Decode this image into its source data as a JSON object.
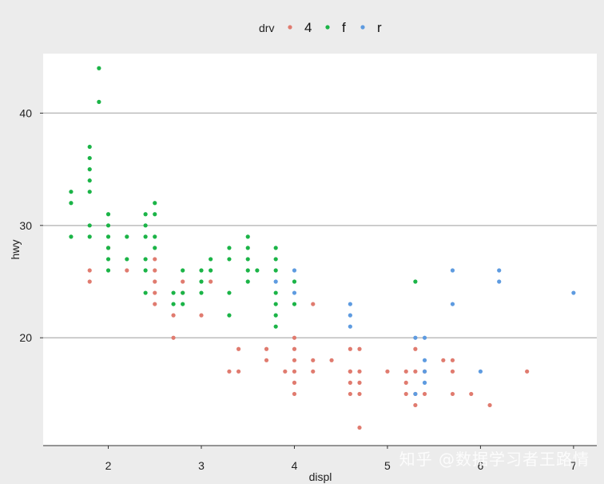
{
  "legend": {
    "title": "drv",
    "entries": [
      {
        "label": "4",
        "color": "#E07B6F"
      },
      {
        "label": "f",
        "color": "#1BB447"
      },
      {
        "label": "r",
        "color": "#5E9BE0"
      }
    ]
  },
  "watermark": "知乎 @数据学习者王路情",
  "chart_data": {
    "type": "scatter",
    "xlabel": "displ",
    "ylabel": "hwy",
    "xlim": [
      1.3,
      7.25
    ],
    "ylim": [
      10.4,
      45.3
    ],
    "xticks": [
      2,
      3,
      4,
      5,
      6,
      7
    ],
    "yticks": [
      20,
      30,
      40
    ],
    "grid": "horizontal-only",
    "legend_position": "top",
    "series": [
      {
        "name": "4",
        "color": "#E07B6F",
        "points": [
          [
            1.8,
            26
          ],
          [
            1.8,
            25
          ],
          [
            2.0,
            28
          ],
          [
            2.2,
            26
          ],
          [
            2.5,
            27
          ],
          [
            2.5,
            26
          ],
          [
            2.5,
            25
          ],
          [
            2.5,
            24
          ],
          [
            2.5,
            23
          ],
          [
            2.7,
            22
          ],
          [
            2.7,
            20
          ],
          [
            2.8,
            25
          ],
          [
            2.8,
            24
          ],
          [
            3.0,
            22
          ],
          [
            3.1,
            25
          ],
          [
            3.3,
            17
          ],
          [
            3.4,
            19
          ],
          [
            3.4,
            17
          ],
          [
            3.7,
            19
          ],
          [
            3.7,
            18
          ],
          [
            3.9,
            17
          ],
          [
            4.0,
            20
          ],
          [
            4.0,
            19
          ],
          [
            4.0,
            18
          ],
          [
            4.0,
            17
          ],
          [
            4.0,
            16
          ],
          [
            4.0,
            15
          ],
          [
            4.2,
            23
          ],
          [
            4.2,
            18
          ],
          [
            4.2,
            17
          ],
          [
            4.4,
            18
          ],
          [
            4.6,
            19
          ],
          [
            4.6,
            17
          ],
          [
            4.6,
            16
          ],
          [
            4.6,
            15
          ],
          [
            4.6,
            17
          ],
          [
            4.7,
            19
          ],
          [
            4.7,
            17
          ],
          [
            4.7,
            16
          ],
          [
            4.7,
            15
          ],
          [
            4.7,
            12
          ],
          [
            5.0,
            17
          ],
          [
            5.2,
            17
          ],
          [
            5.2,
            16
          ],
          [
            5.2,
            15
          ],
          [
            5.3,
            19
          ],
          [
            5.3,
            17
          ],
          [
            5.3,
            15
          ],
          [
            5.3,
            14
          ],
          [
            5.4,
            17
          ],
          [
            5.4,
            15
          ],
          [
            5.6,
            18
          ],
          [
            5.7,
            18
          ],
          [
            5.7,
            17
          ],
          [
            5.7,
            15
          ],
          [
            5.9,
            15
          ],
          [
            6.1,
            14
          ],
          [
            6.5,
            17
          ]
        ]
      },
      {
        "name": "f",
        "color": "#1BB447",
        "points": [
          [
            1.6,
            33
          ],
          [
            1.6,
            32
          ],
          [
            1.6,
            29
          ],
          [
            1.8,
            37
          ],
          [
            1.8,
            36
          ],
          [
            1.8,
            35
          ],
          [
            1.8,
            34
          ],
          [
            1.8,
            33
          ],
          [
            1.8,
            30
          ],
          [
            1.8,
            29
          ],
          [
            1.9,
            44
          ],
          [
            1.9,
            41
          ],
          [
            2.0,
            31
          ],
          [
            2.0,
            30
          ],
          [
            2.0,
            29
          ],
          [
            2.0,
            28
          ],
          [
            2.0,
            27
          ],
          [
            2.0,
            26
          ],
          [
            2.2,
            29
          ],
          [
            2.2,
            27
          ],
          [
            2.4,
            31
          ],
          [
            2.4,
            30
          ],
          [
            2.4,
            29
          ],
          [
            2.4,
            27
          ],
          [
            2.4,
            26
          ],
          [
            2.4,
            24
          ],
          [
            2.5,
            32
          ],
          [
            2.5,
            31
          ],
          [
            2.5,
            29
          ],
          [
            2.5,
            28
          ],
          [
            2.7,
            24
          ],
          [
            2.7,
            23
          ],
          [
            2.8,
            26
          ],
          [
            2.8,
            24
          ],
          [
            2.8,
            23
          ],
          [
            3.0,
            26
          ],
          [
            3.0,
            25
          ],
          [
            3.0,
            24
          ],
          [
            3.1,
            27
          ],
          [
            3.1,
            26
          ],
          [
            3.3,
            28
          ],
          [
            3.3,
            27
          ],
          [
            3.3,
            24
          ],
          [
            3.3,
            22
          ],
          [
            3.5,
            29
          ],
          [
            3.5,
            28
          ],
          [
            3.5,
            27
          ],
          [
            3.5,
            26
          ],
          [
            3.5,
            25
          ],
          [
            3.6,
            26
          ],
          [
            3.8,
            28
          ],
          [
            3.8,
            27
          ],
          [
            3.8,
            26
          ],
          [
            3.8,
            24
          ],
          [
            3.8,
            23
          ],
          [
            3.8,
            22
          ],
          [
            3.8,
            21
          ],
          [
            4.0,
            25
          ],
          [
            4.0,
            23
          ],
          [
            5.3,
            25
          ]
        ]
      },
      {
        "name": "r",
        "color": "#5E9BE0",
        "points": [
          [
            3.8,
            25
          ],
          [
            4.0,
            26
          ],
          [
            4.0,
            24
          ],
          [
            4.6,
            23
          ],
          [
            4.6,
            22
          ],
          [
            4.6,
            21
          ],
          [
            5.3,
            20
          ],
          [
            5.3,
            15
          ],
          [
            5.4,
            20
          ],
          [
            5.4,
            18
          ],
          [
            5.4,
            17
          ],
          [
            5.4,
            16
          ],
          [
            5.7,
            26
          ],
          [
            5.7,
            23
          ],
          [
            6.0,
            17
          ],
          [
            6.2,
            26
          ],
          [
            6.2,
            25
          ],
          [
            7.0,
            24
          ]
        ]
      }
    ]
  }
}
